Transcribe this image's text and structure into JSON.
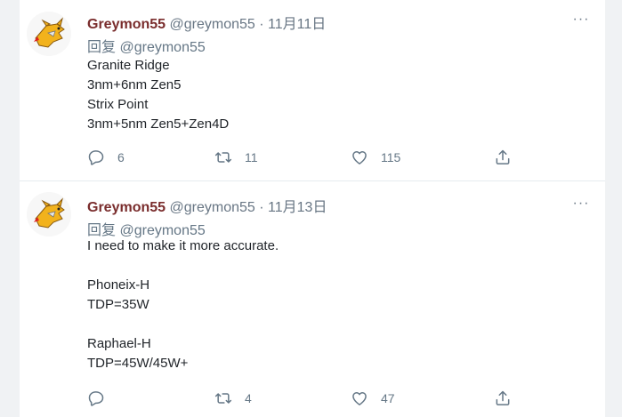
{
  "tweets": [
    {
      "name": "Greymon55",
      "handle": "@greymon55",
      "dot": "·",
      "date": "11月11日",
      "reply_prefix": "回复",
      "reply_mention": "@greymon55",
      "lines": [
        "Granite Ridge",
        "3nm+6nm Zen5",
        "Strix Point",
        "3nm+5nm Zen5+Zen4D"
      ],
      "counts": {
        "replies": "6",
        "retweets": "11",
        "likes": "115"
      }
    },
    {
      "name": "Greymon55",
      "handle": "@greymon55",
      "dot": "·",
      "date": "11月13日",
      "reply_prefix": "回复",
      "reply_mention": "@greymon55",
      "lines": [
        "I need to make it more accurate.",
        "",
        "Phoneix-H",
        "TDP=35W",
        "",
        "Raphael-H",
        "TDP=45W/45W+"
      ],
      "counts": {
        "replies": "",
        "retweets": "4",
        "likes": "47"
      }
    }
  ],
  "more_label": "···",
  "icons": {
    "reply": "reply-icon",
    "retweet": "retweet-icon",
    "like": "heart-icon",
    "share": "share-icon",
    "more": "more-icon",
    "avatar": "avatar-greymon-image"
  },
  "colors": {
    "name": "#7a2d2d",
    "muted": "#687684",
    "text": "#1f2328"
  }
}
